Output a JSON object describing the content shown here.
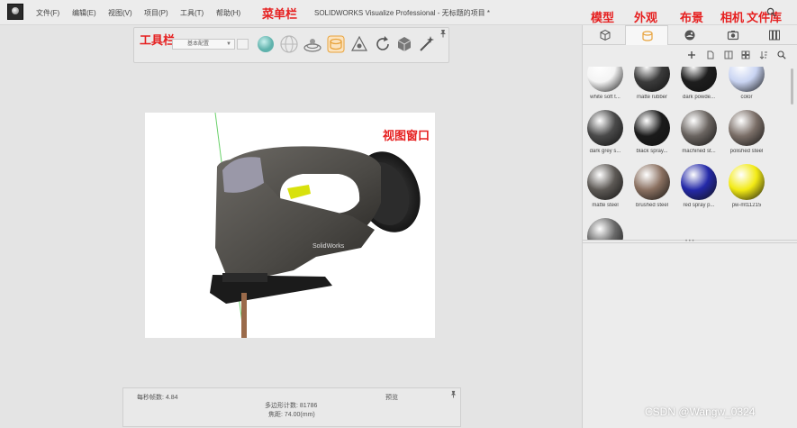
{
  "menubar": {
    "items": [
      "文件(F)",
      "编辑(E)",
      "视图(V)",
      "项目(P)",
      "工具(T)",
      "帮助(H)"
    ],
    "annotation": "菜单栏",
    "window_title": "SOLIDWORKS Visualize Professional - 无标题的项目 *"
  },
  "tab_annotations": [
    "模型",
    "外观",
    "布景",
    "相机",
    "文件库"
  ],
  "toolbar": {
    "annotation": "工具栏",
    "config_select_value": "基本配置",
    "icons": [
      "material-sphere-icon",
      "wire-sphere-icon",
      "floor-icon",
      "appearance-picker-icon",
      "axis-icon",
      "rotate-icon",
      "box-icon",
      "wand-icon"
    ]
  },
  "viewport": {
    "annotation": "视图窗口",
    "brand_text": "SolidWorks"
  },
  "status": {
    "fps": "每秒帧数: 4.84",
    "polygons": "多边形计数: 81786",
    "focal": "焦距: 74.00(mm)",
    "preview": "预览"
  },
  "right_panel": {
    "tabs": [
      "model-tab",
      "appearance-tab",
      "scene-tab",
      "camera-tab",
      "library-tab"
    ],
    "active_tab": 1,
    "materials": [
      {
        "label": "white soft t...",
        "color": "#f4f4f4"
      },
      {
        "label": "matte rubber",
        "color": "#3b3b3b"
      },
      {
        "label": "dark powde...",
        "color": "#1e1e1e"
      },
      {
        "label": "color",
        "color": "#c9d4f2"
      },
      {
        "label": "dark grey s...",
        "color": "#4a4a4a"
      },
      {
        "label": "black spray...",
        "color": "#1b1b1b"
      },
      {
        "label": "machined st...",
        "color": "#6a6460"
      },
      {
        "label": "polished steel",
        "color": "#7b6f68"
      },
      {
        "label": "matte steel",
        "color": "#5d5955"
      },
      {
        "label": "brushed steel",
        "color": "#8a7060"
      },
      {
        "label": "red spray p...",
        "color": "#2429a8"
      },
      {
        "label": "pw-mt11215",
        "color": "#f2ea14"
      },
      {
        "label": "",
        "color": "#6a6a6a"
      }
    ]
  },
  "watermark": "CSDN @Wangw_0324",
  "colors": {
    "annotation": "#e62020",
    "accent_tab": "#e8a33c"
  }
}
